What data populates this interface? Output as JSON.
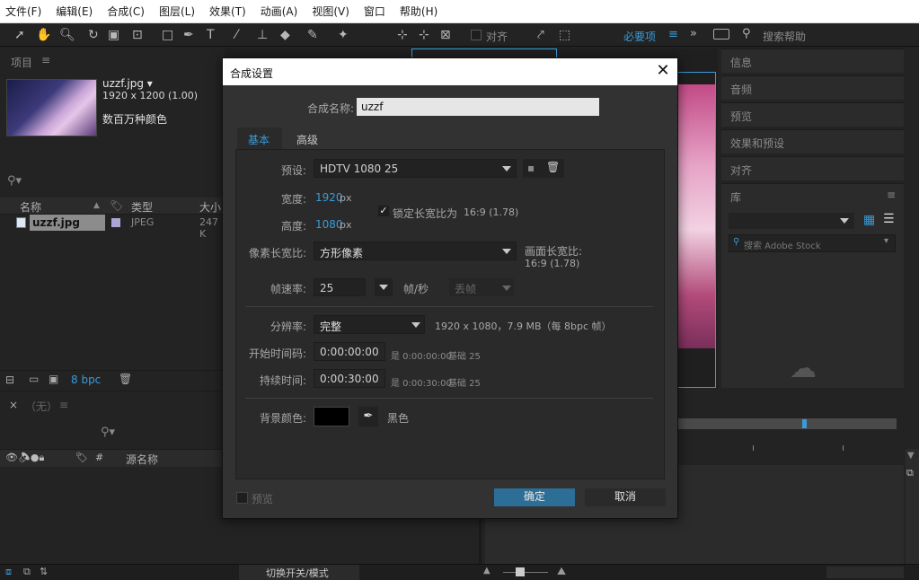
{
  "menu": [
    "文件(F)",
    "编辑(E)",
    "合成(C)",
    "图层(L)",
    "效果(T)",
    "动画(A)",
    "视图(V)",
    "窗口",
    "帮助(H)"
  ],
  "toolbar": {
    "snap_label": "对齐",
    "workspace": "必要项",
    "search_placeholder": "搜索帮助"
  },
  "project": {
    "panel_title": "项目",
    "file_name": "uzzf.jpg ▾",
    "file_dims": "1920 x 1200 (1.00)",
    "file_colors": "数百万种颜色",
    "columns": {
      "name": "名称",
      "type": "类型",
      "size": "大小"
    },
    "row": {
      "name": "uzzf.jpg",
      "type": "JPEG",
      "size": "247 K"
    },
    "bpc": "8 bpc"
  },
  "timeline": {
    "title": "（无）",
    "col_source": "源名称",
    "toggle_label": "切换开关/模式"
  },
  "right_panels": [
    "信息",
    "音频",
    "预览",
    "效果和预设",
    "对齐",
    "库"
  ],
  "library": {
    "search_placeholder": "搜索 Adobe Stock"
  },
  "dialog": {
    "title": "合成设置",
    "comp_name_label": "合成名称:",
    "comp_name_value": "uzzf",
    "tabs": [
      "基本",
      "高级"
    ],
    "preset_label": "预设:",
    "preset_value": "HDTV 1080 25",
    "width_label": "宽度:",
    "width_value": "1920",
    "height_label": "高度:",
    "height_value": "1080",
    "px": "px",
    "lock_label": "锁定长宽比为",
    "lock_ratio": "16:9 (1.78)",
    "pixel_aspect_label": "像素长宽比:",
    "pixel_aspect_value": "方形像素",
    "frame_aspect_label": "画面长宽比:",
    "frame_aspect_value": "16:9 (1.78)",
    "fps_label": "帧速率:",
    "fps_value": "25",
    "fps_unit": "帧/秒",
    "drop_frame": "丢帧",
    "resolution_label": "分辨率:",
    "resolution_value": "完整",
    "resolution_info": "1920 x 1080，7.9 MB（每 8bpc 帧）",
    "start_tc_label": "开始时间码:",
    "start_tc_value": "0:00:00:00",
    "start_tc_info": "是 0:00:00:00",
    "start_tc_base": "基础 25",
    "duration_label": "持续时间:",
    "duration_value": "0:00:30:00",
    "duration_info": "是 0:00:30:00",
    "duration_base": "基础 25",
    "bg_label": "背景颜色:",
    "bg_name": "黑色",
    "preview_label": "预览",
    "ok_label": "确定",
    "cancel_label": "取消"
  },
  "colors": {
    "accent": "#3a9bd9",
    "ok_button": "#2d6e96",
    "bg_color": "#000000"
  }
}
